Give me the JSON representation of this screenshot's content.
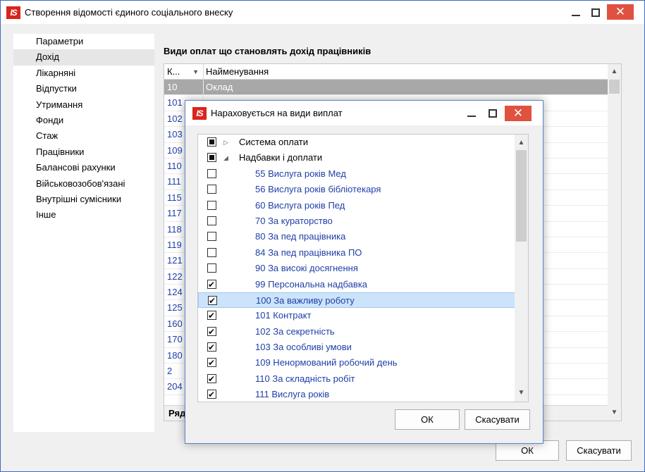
{
  "window": {
    "logo": "IS",
    "title": "Створення відомості єдиного соціального внеску"
  },
  "nav": {
    "items": [
      {
        "label": "Параметри"
      },
      {
        "label": "Дохід",
        "selected": true
      },
      {
        "label": "Лікарняні"
      },
      {
        "label": "Відпустки"
      },
      {
        "label": "Утримання"
      },
      {
        "label": "Фонди"
      },
      {
        "label": "Стаж"
      },
      {
        "label": "Працівники"
      },
      {
        "label": "Балансові рахунки"
      },
      {
        "label": "Військовозобов'язані"
      },
      {
        "label": "Внутрішні сумісники"
      },
      {
        "label": "Інше"
      }
    ]
  },
  "panel": {
    "title": "Види оплат що становлять дохід працівників",
    "columns": {
      "code": "К...",
      "name": "Найменування"
    },
    "rows": [
      {
        "code": "10",
        "name": "Оклад"
      },
      {
        "code": "101",
        "name": ""
      },
      {
        "code": "102",
        "name": ""
      },
      {
        "code": "103",
        "name": ""
      },
      {
        "code": "109",
        "name": ""
      },
      {
        "code": "110",
        "name": ""
      },
      {
        "code": "111",
        "name": ""
      },
      {
        "code": "115",
        "name": ""
      },
      {
        "code": "117",
        "name": ""
      },
      {
        "code": "118",
        "name": ""
      },
      {
        "code": "119",
        "name": ""
      },
      {
        "code": "121",
        "name": ""
      },
      {
        "code": "122",
        "name": ""
      },
      {
        "code": "124",
        "name": ""
      },
      {
        "code": "125",
        "name": ""
      },
      {
        "code": "160",
        "name": ""
      },
      {
        "code": "170",
        "name": ""
      },
      {
        "code": "180",
        "name": ""
      },
      {
        "code": "2",
        "name": ""
      },
      {
        "code": "204",
        "name": ""
      }
    ],
    "footer": "Ряд"
  },
  "main_buttons": {
    "ok": "ОК",
    "cancel": "Скасувати"
  },
  "dialog": {
    "logo": "IS",
    "title": "Нараховується на види виплат",
    "items": [
      {
        "label": "Система оплати",
        "type": "group",
        "state": "mixed",
        "expander": "▷"
      },
      {
        "label": "Надбавки і доплати",
        "type": "group",
        "state": "mixed",
        "expander": "◢"
      },
      {
        "label": "55 Вислуга років Мед",
        "type": "leaf",
        "state": "unchecked"
      },
      {
        "label": "56 Вислуга років бібліотекаря",
        "type": "leaf",
        "state": "unchecked"
      },
      {
        "label": "60 Вислуга років Пед",
        "type": "leaf",
        "state": "unchecked"
      },
      {
        "label": "70 За кураторство",
        "type": "leaf",
        "state": "unchecked"
      },
      {
        "label": "80 За пед працівника",
        "type": "leaf",
        "state": "unchecked"
      },
      {
        "label": "84 За пед працівника ПО",
        "type": "leaf",
        "state": "unchecked"
      },
      {
        "label": "90 За високі досягнення",
        "type": "leaf",
        "state": "unchecked"
      },
      {
        "label": "99 Персональна надбавка",
        "type": "leaf",
        "state": "checked"
      },
      {
        "label": "100 За важливу роботу",
        "type": "leaf",
        "state": "checked",
        "highlighted": true
      },
      {
        "label": "101 Контракт",
        "type": "leaf",
        "state": "checked"
      },
      {
        "label": "102 За секретність",
        "type": "leaf",
        "state": "checked"
      },
      {
        "label": "103 За особливі умови",
        "type": "leaf",
        "state": "checked"
      },
      {
        "label": "109 Ненормований робочий день",
        "type": "leaf",
        "state": "checked"
      },
      {
        "label": "110 За складність робіт",
        "type": "leaf",
        "state": "checked"
      },
      {
        "label": "111 Вислуга років",
        "type": "leaf",
        "state": "checked"
      }
    ],
    "buttons": {
      "ok": "ОК",
      "cancel": "Скасувати"
    }
  },
  "colors": {
    "link_blue": "#1f3fa8",
    "close_red": "#e0513f",
    "logo_red": "#d9251c",
    "selection_gray": "#a8a8a8",
    "highlight_blue": "#cce4fb"
  }
}
